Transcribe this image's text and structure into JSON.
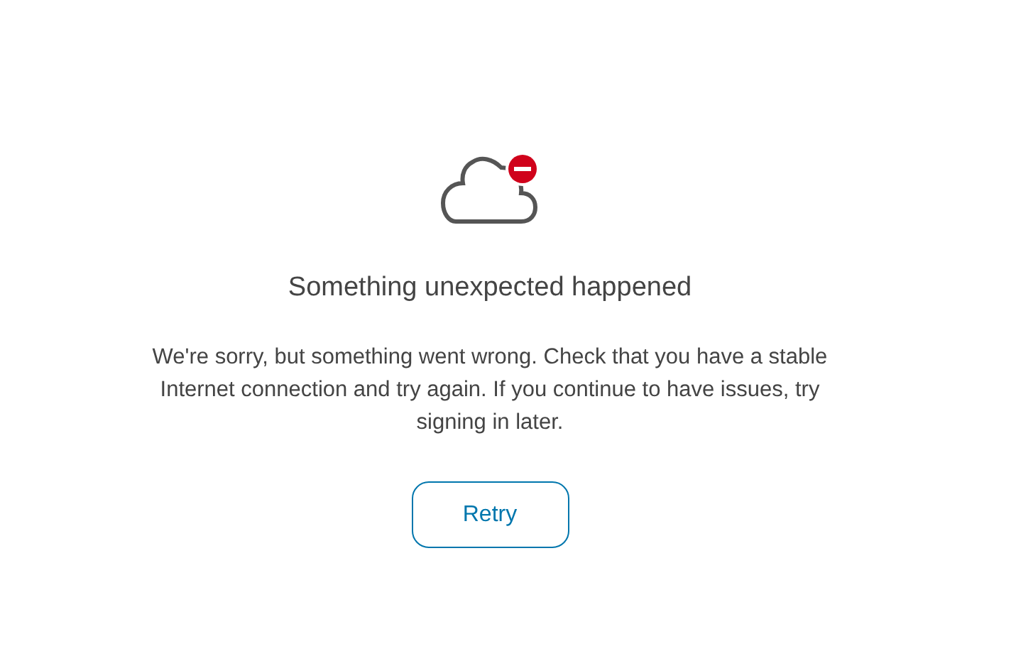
{
  "error": {
    "title": "Something unexpected happened",
    "message": "We're sorry, but something went wrong. Check that you have a stable Internet connection and try again. If you continue to have issues, try signing in later.",
    "button": "Retry"
  }
}
